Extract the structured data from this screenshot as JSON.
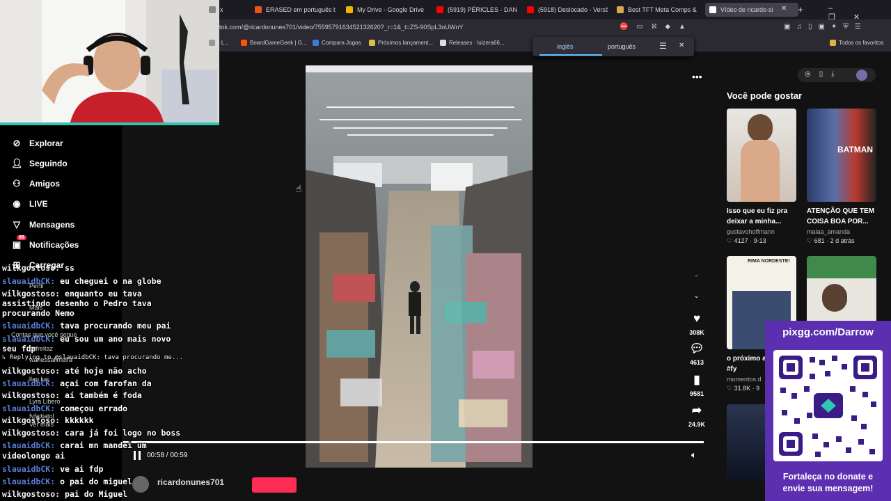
{
  "tabs": [
    {
      "label": "x",
      "color": "#888"
    },
    {
      "label": "ERASED em português bras",
      "color": "#e8541c"
    },
    {
      "label": "My Drive - Google Drive",
      "color": "#f2b400"
    },
    {
      "label": "(5919) PÉRICLES - DANÇA",
      "color": "#ff0000"
    },
    {
      "label": "(5918) Deslocado - Versão",
      "color": "#ff0000"
    },
    {
      "label": "Best TFT Meta Comps & Bu",
      "color": "#d4a94f"
    },
    {
      "label": "Vídeo de ricardo-si",
      "color": "#fff"
    }
  ],
  "url": "tok.com/@ricardonunes701/video/7559579163452132620?_r=1&_t=ZS-90SpL3oUWnY",
  "bookmarks": [
    {
      "label": "- L...",
      "color": "#999"
    },
    {
      "label": "BoardGameGeek | G...",
      "color": "#ff5100"
    },
    {
      "label": "Compara Jogos",
      "color": "#3a7bd5"
    },
    {
      "label": "Próximos lançament...",
      "color": "#d8c04a"
    },
    {
      "label": "Releases · luizera66...",
      "color": "#ddd"
    },
    {
      "label": "Todos os favoritos",
      "color": "#e0b040"
    }
  ],
  "translate": {
    "lang_from": "inglês",
    "lang_to": "português"
  },
  "nav": [
    {
      "label": "Explorar",
      "icon": "compass-icon"
    },
    {
      "label": "Seguindo",
      "icon": "person-icon"
    },
    {
      "label": "Amigos",
      "icon": "people-icon"
    },
    {
      "label": "LIVE",
      "icon": "live-icon"
    },
    {
      "label": "Mensagens",
      "icon": "send-icon"
    },
    {
      "label": "Notificações",
      "icon": "inbox-icon",
      "badge": "98"
    },
    {
      "label": "Carregar",
      "icon": "upload-icon"
    }
  ],
  "sidebar_ghost": [
    "Perfil",
    "Mais",
    "Contas que você segue",
    "pvfreitaz",
    "wanessalimeira",
    "llan.kai",
    "Lyra Libero",
    "fvfaitiatol",
    "Ver mais"
  ],
  "player": {
    "time": "00:58 / 00:59",
    "progress": 0.98
  },
  "actions": [
    {
      "icon": "heart-icon",
      "count": "308K"
    },
    {
      "icon": "comment-icon",
      "count": "4613"
    },
    {
      "icon": "bookmark-icon",
      "count": "9581"
    },
    {
      "icon": "share-icon",
      "count": "24.9K"
    }
  ],
  "author": "ricardonunes701",
  "recommend": {
    "heading": "Você pode gostar",
    "cards": [
      {
        "title": "Isso que eu fiz pra deixar a minha...",
        "user": "gustavohoffmann",
        "likes": "4127",
        "date": "9-13"
      },
      {
        "title": "ATENÇÃO QUE TEM COISA BOA POR...",
        "user": "maiaa_amanda",
        "likes": "681",
        "date": "2 d atrás"
      },
      {
        "title": "o próximo a JOTAPÉ #fy",
        "user": "momentos.d",
        "likes": "31.8K",
        "date": "9",
        "thumb_text": "RIMA NORDESTE!"
      }
    ]
  },
  "chat": [
    {
      "user": "wilkgostoso:",
      "text": "ss",
      "color": "u1"
    },
    {
      "user": "slauaidbCK:",
      "text": "eu cheguei o na globe",
      "color": "u2"
    },
    {
      "user": "wilkgostoso:",
      "text": "enquanto eu tava",
      "color": "u1"
    },
    {
      "user": "",
      "text": "assistindo desenho o Pedro tava",
      "color": "u1"
    },
    {
      "user": "",
      "text": "procurando Nemo",
      "color": "u1"
    },
    {
      "user": "slauaidbCK:",
      "text": "tava procurando meu pai",
      "color": "u2"
    },
    {
      "user": "slauaidbCK:",
      "text": "eu sou um ano mais novo",
      "color": "u2"
    },
    {
      "user": "",
      "text": "seu fdp",
      "color": "u2"
    },
    {
      "user": "↳ Replying to @slauaidbCK: tava procurando me...",
      "text": "",
      "color": "u1"
    },
    {
      "user": "wilkgostoso:",
      "text": "até hoje não acho",
      "color": "u1"
    },
    {
      "user": "slauaidbCK:",
      "text": "açai com farofan da",
      "color": "u2"
    },
    {
      "user": "wilkgostoso:",
      "text": "aí também é foda",
      "color": "u1"
    },
    {
      "user": "slauaidbCK:",
      "text": "começou errado",
      "color": "u2"
    },
    {
      "user": "wilkgostoso:",
      "text": "kkkkkk",
      "color": "u1"
    },
    {
      "user": "wilkgostoso:",
      "text": "cara já foi logo no boss",
      "color": "u1"
    },
    {
      "user": "slauaidbCK:",
      "text": "carai mn mandei um",
      "color": "u2"
    },
    {
      "user": "",
      "text": "videolongo ai",
      "color": "u2"
    },
    {
      "user": "slauaidbCK:",
      "text": "ve ai fdp",
      "color": "u2"
    },
    {
      "user": "slauaidbCK:",
      "text": "o pai do miguel",
      "color": "u2"
    },
    {
      "user": "wilkgostoso:",
      "text": "pai do Miguel",
      "color": "u1"
    }
  ],
  "donate": {
    "site": "pixgg.com/Darrow",
    "message": "Fortaleça no donate e envie sua mensagem!"
  }
}
